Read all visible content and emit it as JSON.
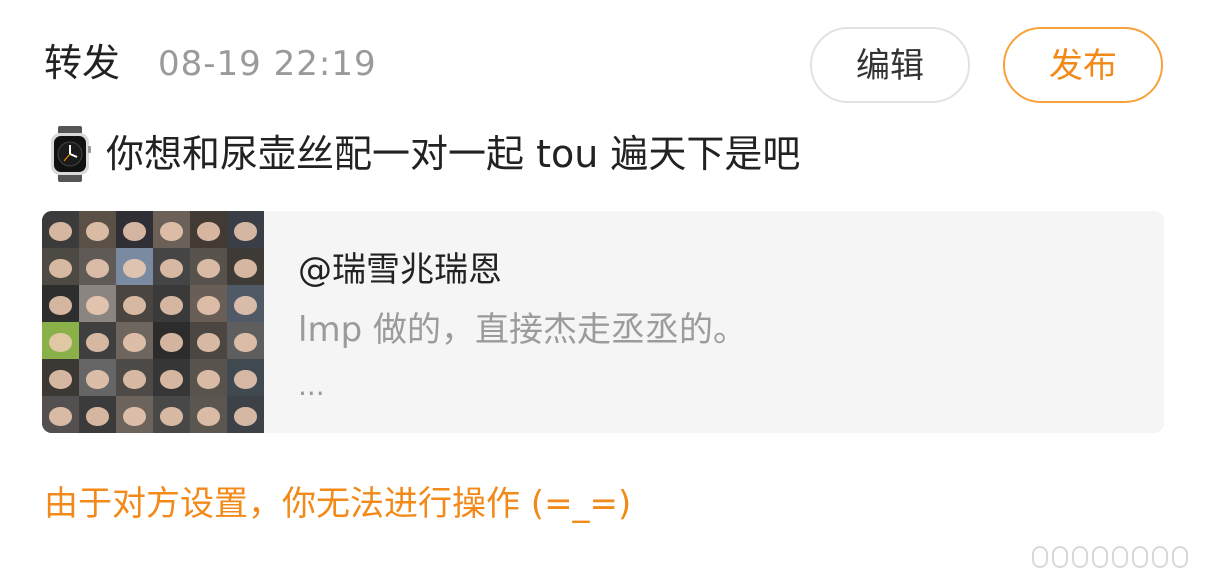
{
  "header": {
    "title": "转发",
    "timestamp": "08-19 22:19",
    "edit_label": "编辑",
    "publish_label": "发布"
  },
  "post": {
    "icon": "smartwatch-icon",
    "text": "你想和尿壶丝配一对一起 tou 遍天下是吧"
  },
  "quoted_card": {
    "thumbnail": "face-collage-image",
    "author": "@瑞雪兆瑞恩",
    "snippet": "lmp 做的，直接杰走丞丞的。",
    "ellipsis": "..."
  },
  "notice": "由于对方设置，你无法进行操作 (=_=)",
  "colors": {
    "accent": "#f28a1a",
    "accent_border": "#f7a23c",
    "muted_text": "#9b9b9b",
    "card_bg": "#f5f5f5"
  }
}
